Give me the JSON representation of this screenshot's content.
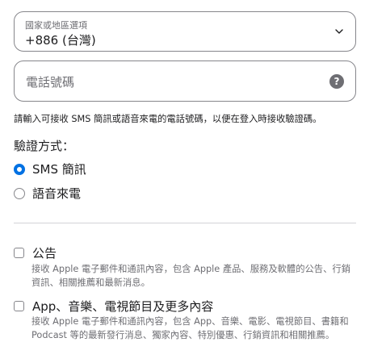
{
  "country_select": {
    "label": "國家或地區選項",
    "value": "+886 (台灣)"
  },
  "phone": {
    "placeholder": "電話號碼",
    "help": "?"
  },
  "hint_text": "請輸入可接收 SMS 簡訊或語音來電的電話號碼，以便在登入時接收驗證碼。",
  "verification": {
    "label": "驗證方式：",
    "options": [
      {
        "label": "SMS 簡訊",
        "selected": true
      },
      {
        "label": "語音來電",
        "selected": false
      }
    ]
  },
  "subscriptions": [
    {
      "title": "公告",
      "description": "接收 Apple 電子郵件和通訊內容，包含 Apple 產品、服務及軟體的公告、行銷資訊、相關推薦和最新消息。",
      "checked": false
    },
    {
      "title": "App、音樂、電視節目及更多內容",
      "description": "接收 Apple 電子郵件和通訊內容，包含 App、音樂、電影、電視節目、書籍和 Podcast 等的最新發行消息、獨家內容、特別優惠、行銷資訊和相關推薦。",
      "checked": false
    }
  ],
  "colors": {
    "accent": "#0071e3",
    "border": "#86868b",
    "secondary_text": "#6e6e73"
  }
}
